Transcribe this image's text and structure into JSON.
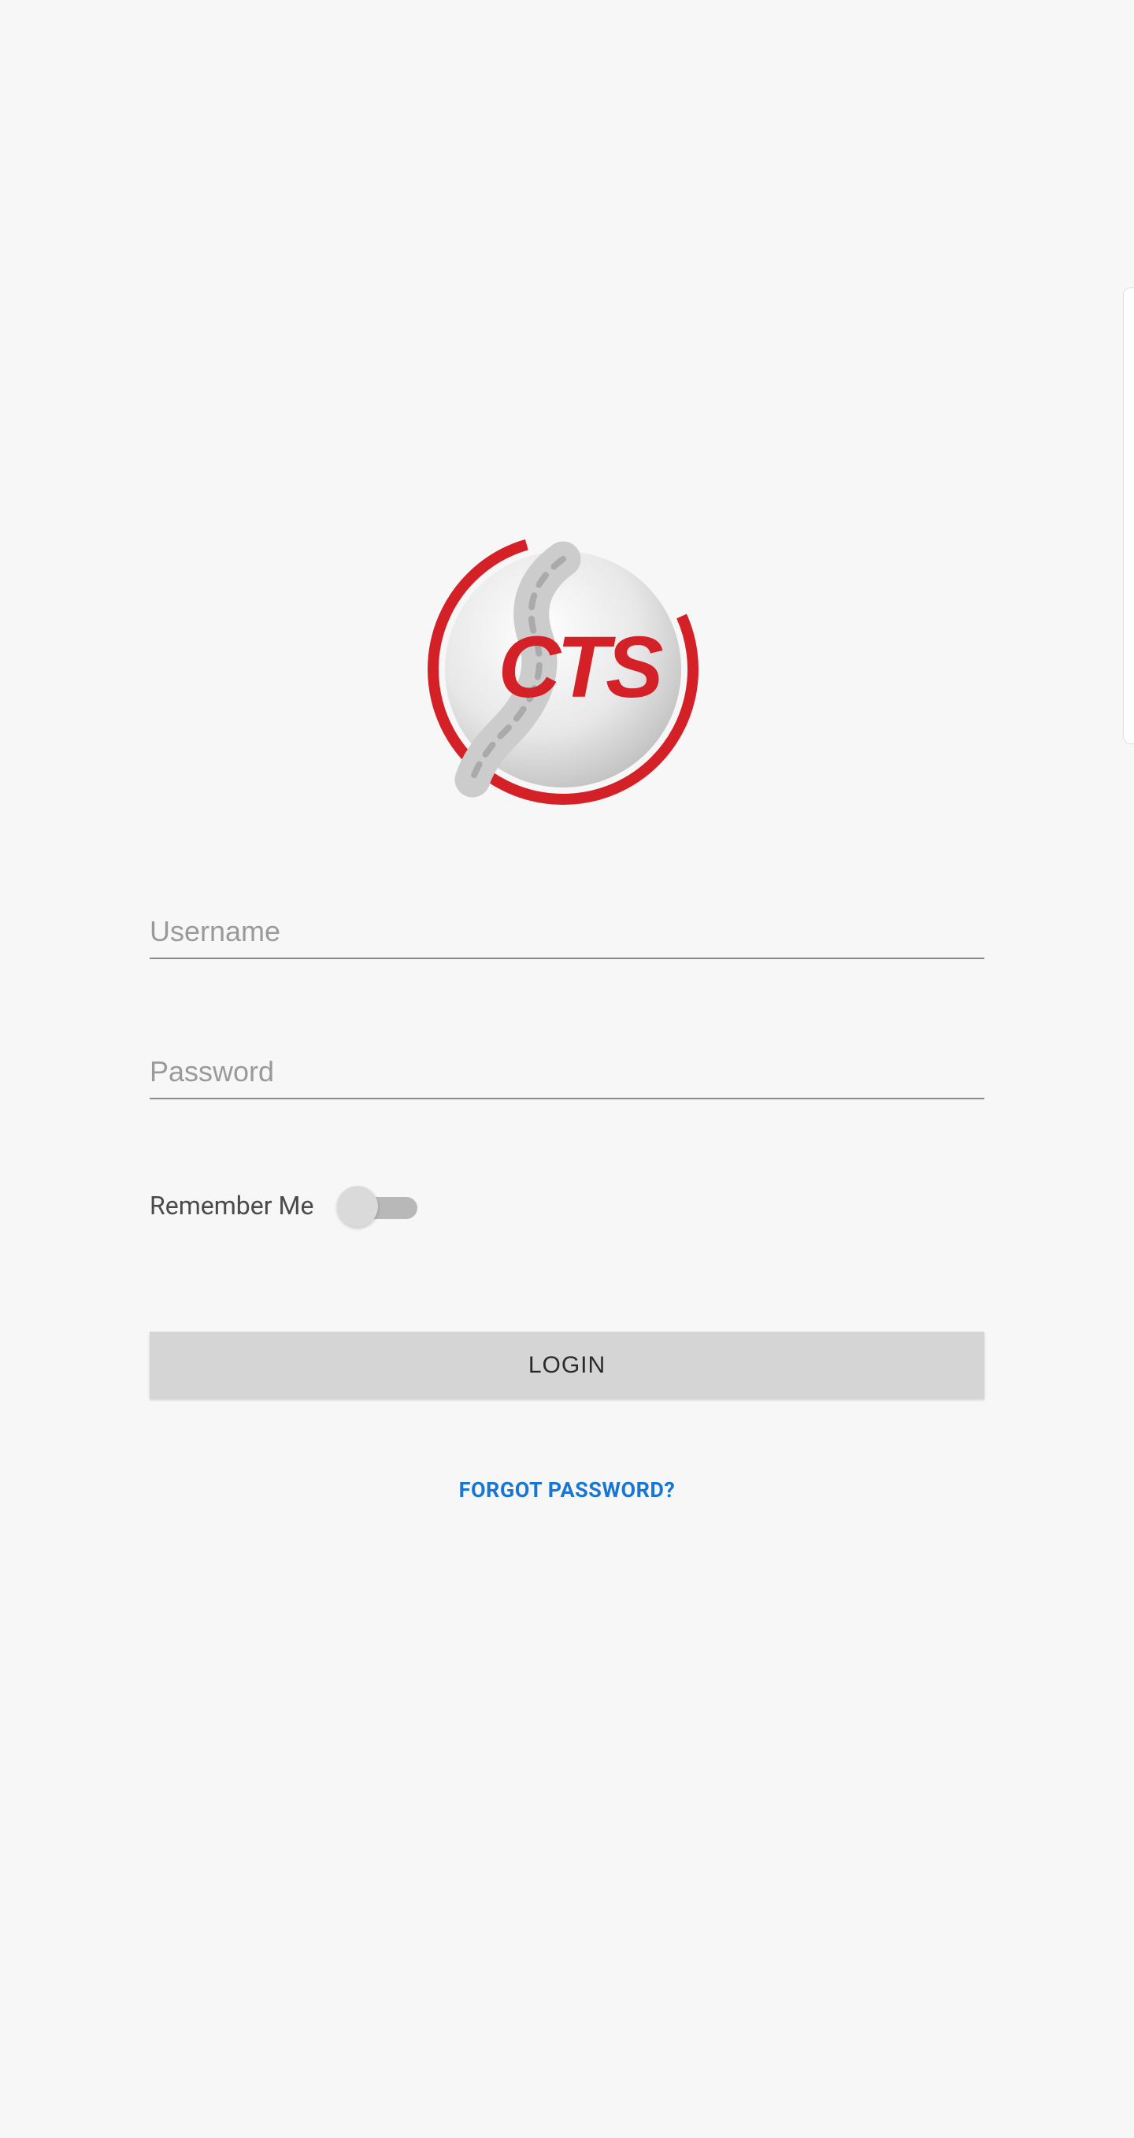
{
  "logo": {
    "text": "CTS",
    "iconName": "cts-logo"
  },
  "form": {
    "usernamePlaceholder": "Username",
    "passwordPlaceholder": "Password",
    "rememberLabel": "Remember Me",
    "loginLabel": "LOGIN",
    "forgotLabel": "FORGOT PASSWORD?"
  },
  "colors": {
    "brandRed": "#d42027",
    "linkBlue": "#1976d2"
  }
}
